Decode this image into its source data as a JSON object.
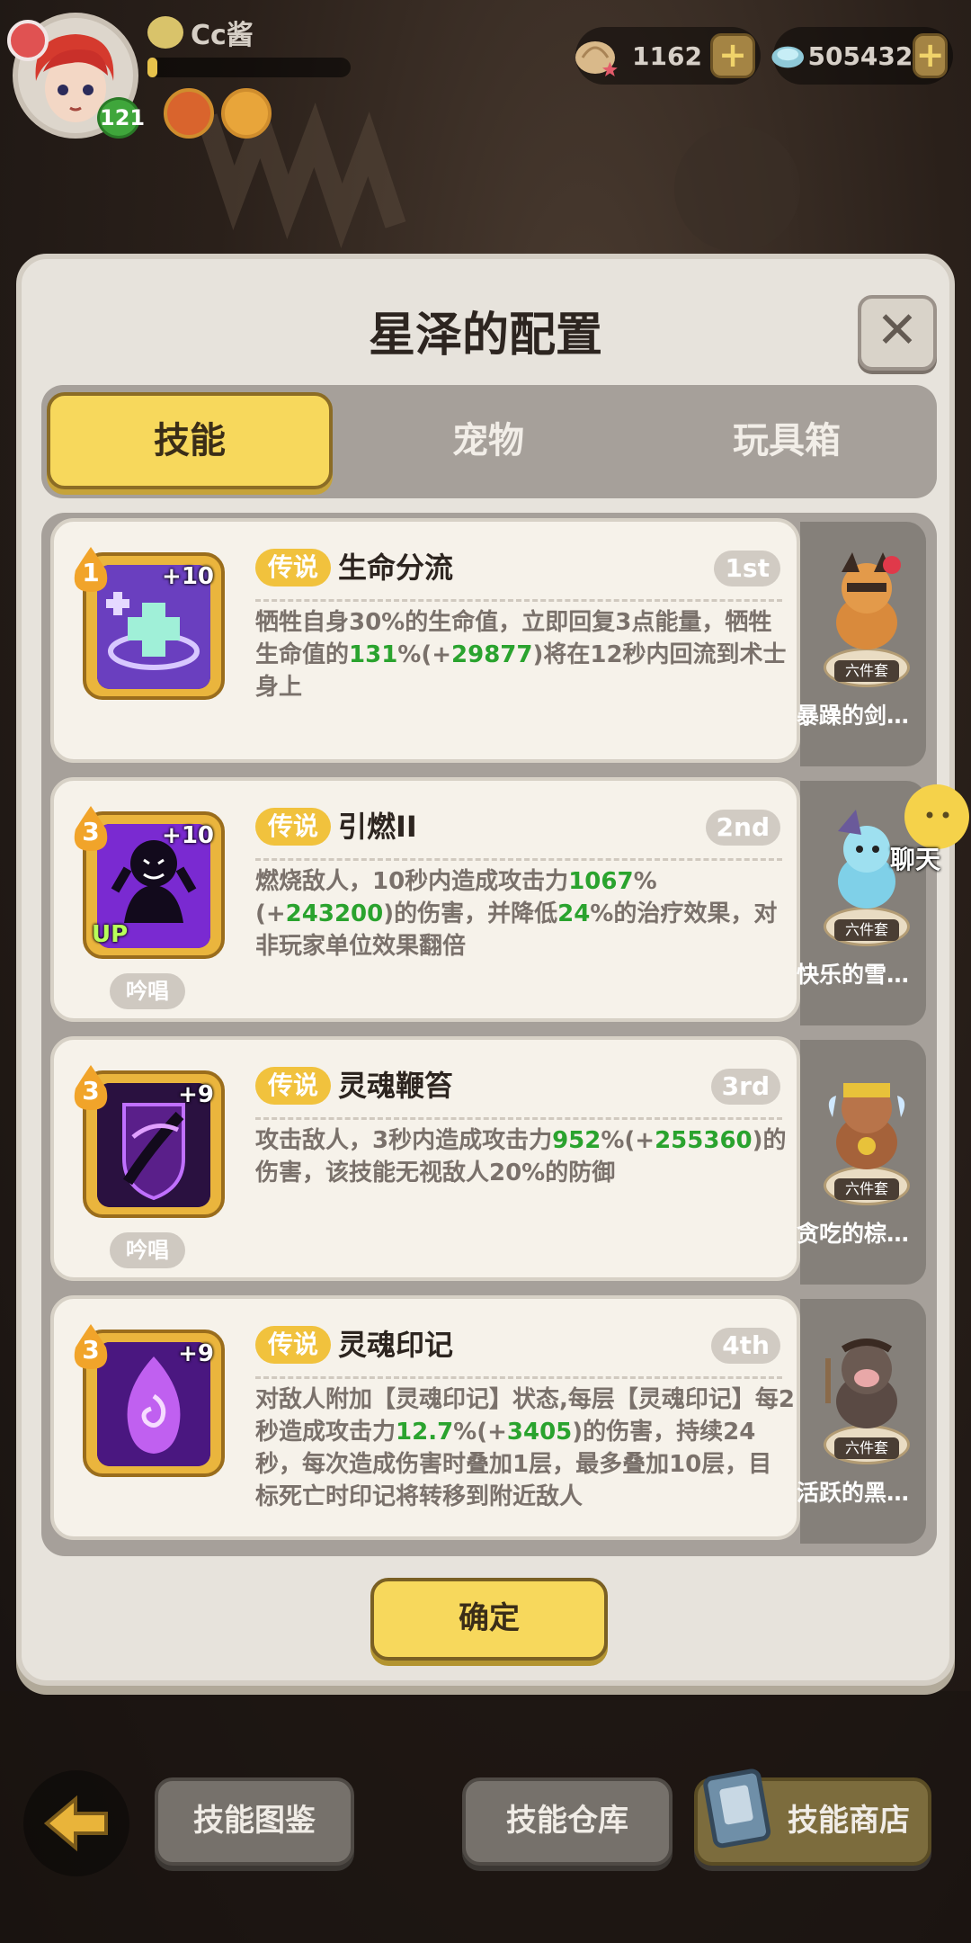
{
  "hud": {
    "player_name": "Cc酱",
    "level": "121",
    "exp_progress": 0.05,
    "currencies": [
      {
        "icon": "shell-icon",
        "value": "1162"
      },
      {
        "icon": "crystal-icon",
        "value": "505432"
      }
    ]
  },
  "panel": {
    "title": "星泽的配置",
    "close_label": "✕",
    "tabs": [
      {
        "label": "技能",
        "active": true
      },
      {
        "label": "宠物",
        "active": false
      },
      {
        "label": "玩具箱",
        "active": false
      }
    ],
    "confirm_label": "确定"
  },
  "skills": [
    {
      "rank": "1",
      "plus": "+10",
      "up": "",
      "chant": "",
      "rarity": "传说",
      "name": "生命分流",
      "order": "1st",
      "desc_parts": [
        "牺牲自身30%的生命值，立即回复3点能量，牺牲生命值的",
        "131",
        "%(+",
        "29877",
        ")将在12秒内回流到术士身上"
      ],
      "icon": "heal-cross-icon"
    },
    {
      "rank": "3",
      "plus": "+10",
      "up": "UP",
      "chant": "吟唱",
      "rarity": "传说",
      "name": "引燃II",
      "order": "2nd",
      "desc_parts": [
        "燃烧敌人，10秒内造成攻击力",
        "1067",
        "%(+",
        "243200",
        ")的伤害，并降低",
        "24",
        "%的治疗效果，对非玩家单位效果翻倍"
      ],
      "icon": "ignite-figure-icon"
    },
    {
      "rank": "3",
      "plus": "+9",
      "up": "",
      "chant": "吟唱",
      "rarity": "传说",
      "name": "灵魂鞭笞",
      "order": "3rd",
      "desc_parts": [
        "攻击敌人，3秒内造成攻击力",
        "952",
        "%(+",
        "255360",
        ")的伤害，该技能无视敌人20%的防御"
      ],
      "icon": "soul-whip-icon"
    },
    {
      "rank": "3",
      "plus": "+9",
      "up": "",
      "chant": "",
      "rarity": "传说",
      "name": "灵魂印记",
      "order": "4th",
      "desc_parts": [
        "对敌人附加【灵魂印记】状态,每层【灵魂印记】每2秒造成攻击力",
        "12.7",
        "%(+",
        "3405",
        ")的伤害，持续24秒，每次造成伤害时叠加1层，最多叠加10层，目标死亡时印记将转移到附近敌人"
      ],
      "icon": "soul-mark-flame-icon"
    }
  ],
  "toys": [
    {
      "set_tag": "六件套",
      "name": "暴躁的剑…"
    },
    {
      "set_tag": "六件套",
      "name": "快乐的雪…"
    },
    {
      "set_tag": "六件套",
      "name": "贪吃的棕…"
    },
    {
      "set_tag": "六件套",
      "name": "活跃的黑…"
    }
  ],
  "chat": {
    "label": "聊天"
  },
  "bottom": {
    "buttons": [
      {
        "label": "技能图鉴"
      },
      {
        "label": "技能仓库"
      },
      {
        "label": "技能商店"
      }
    ]
  },
  "colors": {
    "accent_yellow": "#f7d85c",
    "highlight_green": "#2aa32e",
    "legend_tag": "#f1c23d"
  }
}
